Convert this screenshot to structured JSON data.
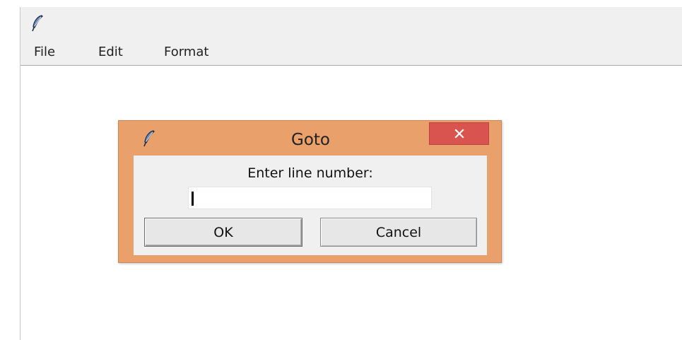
{
  "window": {
    "icon": "feather-icon",
    "menu": [
      "File",
      "Edit",
      "Format"
    ]
  },
  "dialog": {
    "icon": "feather-icon",
    "title": "Goto",
    "close_icon": "close-icon",
    "prompt": "Enter line number:",
    "input_value": "",
    "ok_label": "OK",
    "cancel_label": "Cancel"
  },
  "colors": {
    "dialog_frame": "#e9a06b",
    "close_button": "#d9534f",
    "chrome": "#f0f0f0"
  }
}
